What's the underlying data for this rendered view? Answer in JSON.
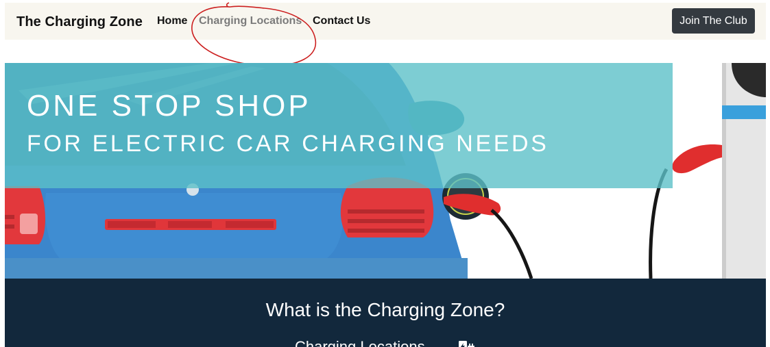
{
  "navbar": {
    "brand": "The Charging Zone",
    "links": [
      {
        "label": "Home"
      },
      {
        "label": "Charging Locations"
      },
      {
        "label": "Contact Us"
      }
    ],
    "join_button": "Join The Club"
  },
  "hero": {
    "title": "ONE STOP SHOP",
    "subtitle": "FOR ELECTRIC CAR CHARGING NEEDS"
  },
  "info": {
    "heading": "What is the Charging Zone?",
    "link_label": "Charging Locations",
    "link_icon": "ev-charger-icon"
  },
  "colors": {
    "navbar_bg": "#f8f6ef",
    "button_bg": "#343a40",
    "banner_overlay": "#5cc0c8",
    "section_bg": "#12283c",
    "annotation": "#cc1f1f"
  }
}
